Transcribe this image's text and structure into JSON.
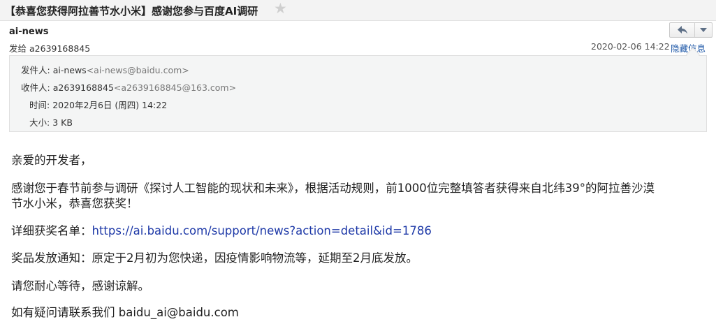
{
  "subject": "【恭喜您获得阿拉善节水小米】感谢您参与百度AI调研",
  "sender": "ai-news",
  "recipient_prefix": "发给",
  "recipient": "a2639168845",
  "date": "2020-02-06 14:22",
  "hide_info": "隐藏信息",
  "details": {
    "from_label": "发件人:",
    "from_name": "ai-news",
    "from_addr": "<ai-news@baidu.com>",
    "to_label": "收件人:",
    "to_name": "a2639168845",
    "to_addr": "<a2639168845@163.com>",
    "time_label": "时间:",
    "time_value": "2020年2月6日 (周四) 14:22",
    "size_label": "大小:",
    "size_value": "3 KB"
  },
  "body": {
    "greeting": "亲爱的开发者，",
    "para1_line1": "感谢您于春节前参与调研《探讨人工智能的现状和未来》，根据活动规则，前1000位完整填答者获得来自北纬39°的阿拉善沙漠",
    "para1_line2": "节水小米，恭喜您获奖！",
    "list_label": "详细获奖名单：",
    "list_link": "https://ai.baidu.com/support/news?action=detail&id=1786",
    "notice": "奖品发放通知：原定于2月初为您快递，因疫情影响物流等，延期至2月底发放。",
    "patience": "请您耐心等待，感谢谅解。",
    "contact": "如有疑问请联系我们 baidu_ai@baidu.com"
  },
  "icons": {
    "star": "star-icon",
    "reply": "reply-icon",
    "more": "chevron-down-icon"
  }
}
